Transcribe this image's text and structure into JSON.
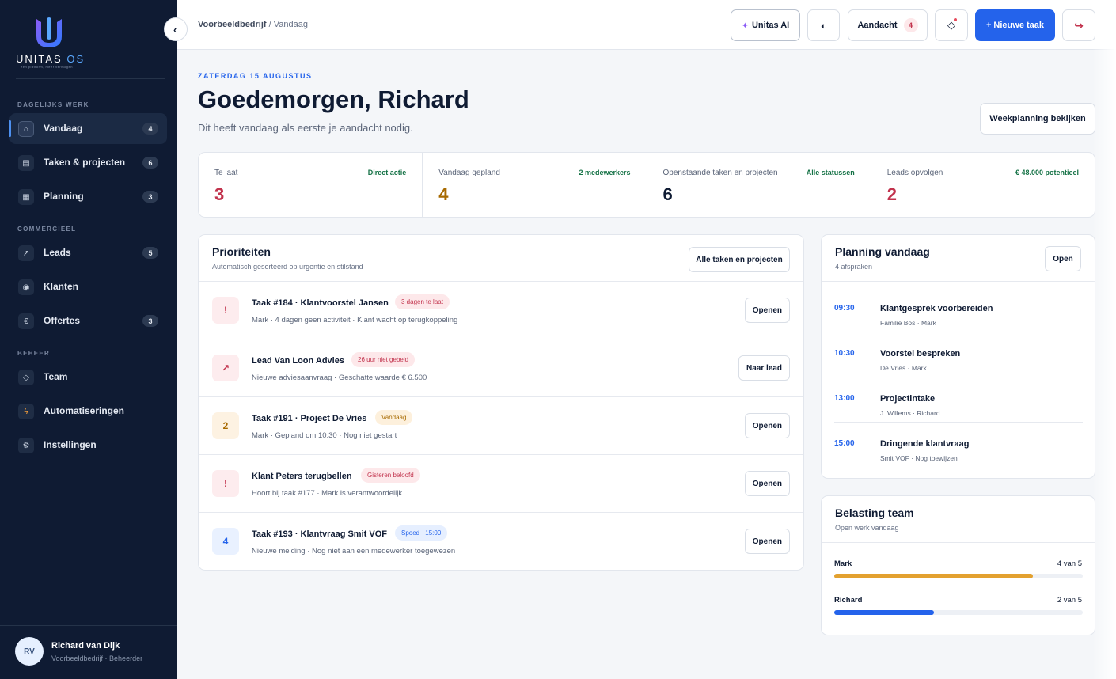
{
  "brand": {
    "name": "UNITAS",
    "suffix": "OS",
    "tagline": "een platform, meer vermogen"
  },
  "sidebar": {
    "sections": [
      {
        "label": "DAGELIJKS WERK"
      },
      {
        "label": "COMMERCIEEL"
      },
      {
        "label": "BEHEER"
      }
    ],
    "items": [
      {
        "label": "Vandaag",
        "icon": "home-icon",
        "badge": "4",
        "active": true
      },
      {
        "label": "Taken & projecten",
        "icon": "tasks-icon",
        "badge": "6"
      },
      {
        "label": "Planning",
        "icon": "calendar-icon",
        "badge": "3"
      },
      {
        "label": "Leads",
        "icon": "arrow-up-right-icon",
        "badge": "5"
      },
      {
        "label": "Klanten",
        "icon": "eye-icon"
      },
      {
        "label": "Offertes",
        "icon": "euro-icon",
        "badge": "3"
      },
      {
        "label": "Team",
        "icon": "diamond-icon"
      },
      {
        "label": "Automatiseringen",
        "icon": "bolt-icon"
      },
      {
        "label": "Instellingen",
        "icon": "gear-icon"
      }
    ],
    "user": {
      "initials": "RV",
      "name": "Richard van Dijk",
      "role": "Voorbeeldbedrijf · Beheerder"
    }
  },
  "topbar": {
    "breadcrumb_company": "Voorbeeldbedrijf",
    "breadcrumb_page": "Vandaag",
    "ai_label": "Unitas AI",
    "attention_label": "Aandacht",
    "attention_count": "4",
    "new_task_label": "+ Nieuwe taak"
  },
  "header": {
    "date": "ZATERDAG 15 AUGUSTUS",
    "greeting": "Goedemorgen, Richard",
    "subtitle": "Dit heeft vandaag als eerste je aandacht nodig.",
    "week_button": "Weekplanning bekijken"
  },
  "stats": [
    {
      "label": "Te laat",
      "link": "Direct actie",
      "value": "3",
      "color": "#c2334d"
    },
    {
      "label": "Vandaag gepland",
      "link": "2 medewerkers",
      "value": "4",
      "color": "#a86a00"
    },
    {
      "label": "Openstaande taken en projecten",
      "link": "Alle statussen",
      "value": "6",
      "color": "#0f1b33"
    },
    {
      "label": "Leads opvolgen",
      "link": "€ 48.000 potentieel",
      "value": "2",
      "color": "#c2334d"
    }
  ],
  "priorities": {
    "title": "Prioriteiten",
    "subtitle": "Automatisch gesorteerd op urgentie en stilstand",
    "button": "Alle taken en projecten",
    "rows": [
      {
        "icon": "!",
        "title": "Taak #184 · Klantvoorstel Jansen",
        "tag": "3 dagen te laat",
        "desc": "Mark · 4 dagen geen activiteit · Klant wacht op terugkoppeling",
        "action": "Openen",
        "tone": "red"
      },
      {
        "icon": "↗",
        "title": "Lead Van Loon Advies",
        "tag": "26 uur niet gebeld",
        "desc": "Nieuwe adviesaanvraag · Geschatte waarde € 6.500",
        "action": "Naar lead",
        "tone": "red"
      },
      {
        "icon": "2",
        "title": "Taak #191 · Project De Vries",
        "tag": "Vandaag",
        "desc": "Mark · Gepland om 10:30 · Nog niet gestart",
        "action": "Openen",
        "tone": "orange"
      },
      {
        "icon": "!",
        "title": "Klant Peters terugbellen",
        "tag": "Gisteren beloofd",
        "desc": "Hoort bij taak #177 · Mark is verantwoordelijk",
        "action": "Openen",
        "tone": "red"
      },
      {
        "icon": "4",
        "title": "Taak #193 · Klantvraag Smit VOF",
        "tag": "Spoed · 15:00",
        "desc": "Nieuwe melding · Nog niet aan een medewerker toegewezen",
        "action": "Openen",
        "tone": "blue"
      }
    ]
  },
  "schedule": {
    "title": "Planning vandaag",
    "subtitle": "4 afspraken",
    "button": "Open",
    "items": [
      {
        "time": "09:30",
        "title": "Klantgesprek voorbereiden",
        "sub": "Familie Bos · Mark"
      },
      {
        "time": "10:30",
        "title": "Voorstel bespreken",
        "sub": "De Vries · Mark"
      },
      {
        "time": "13:00",
        "title": "Projectintake",
        "sub": "J. Willems · Richard"
      },
      {
        "time": "15:00",
        "title": "Dringende klantvraag",
        "sub": "Smit VOF · Nog toewijzen"
      }
    ]
  },
  "team_load": {
    "title": "Belasting team",
    "subtitle": "Open werk vandaag",
    "members": [
      {
        "name": "Mark",
        "value": "4 van 5",
        "fraction": 0.8,
        "color": "#e3a12f"
      },
      {
        "name": "Richard",
        "value": "2 van 5",
        "fraction": 0.4,
        "color": "#2463eb"
      }
    ]
  }
}
